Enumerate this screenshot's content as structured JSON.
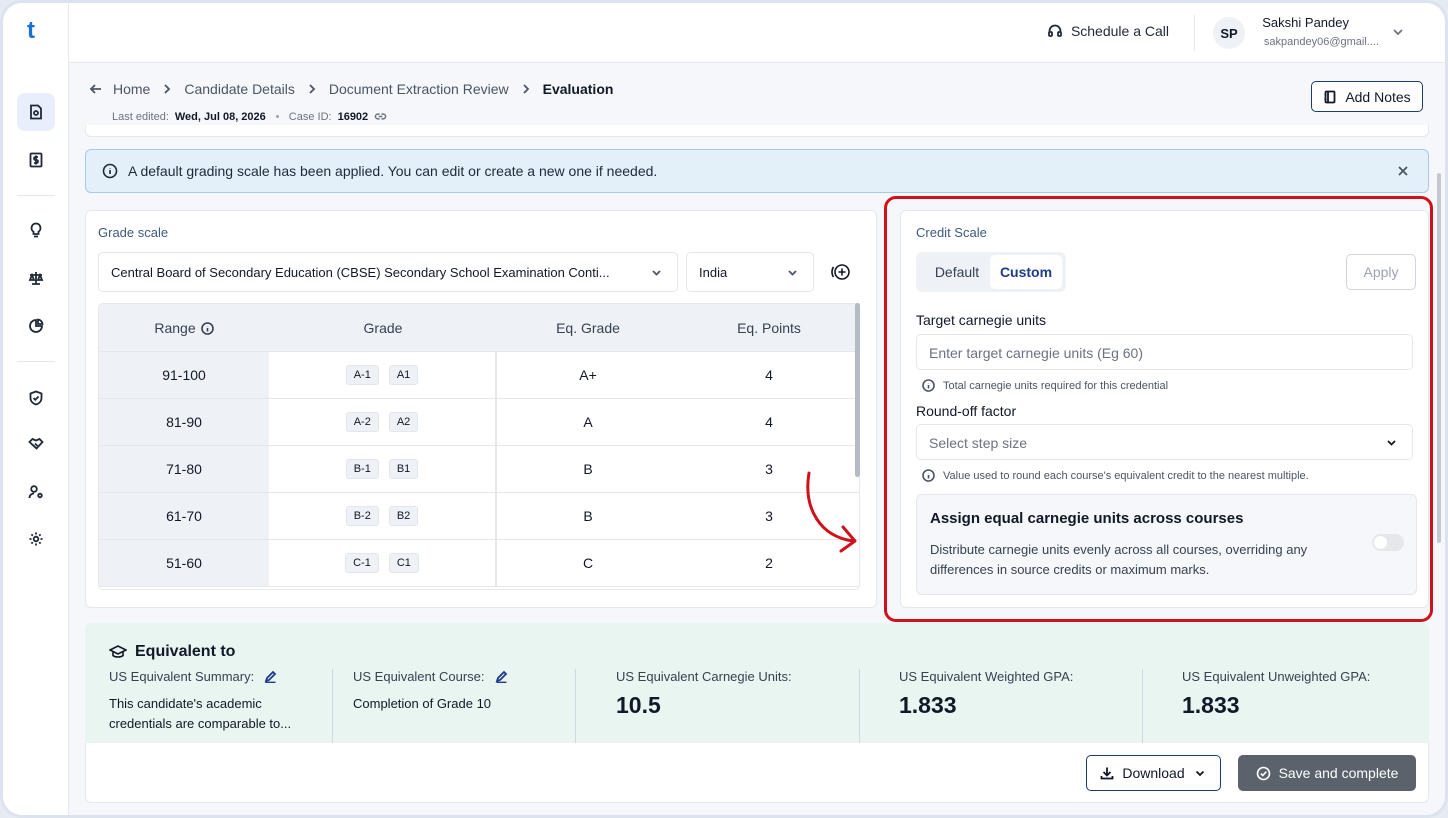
{
  "app": {
    "logo": "t"
  },
  "topbar": {
    "schedule_label": "Schedule a Call",
    "user_initials": "SP",
    "user_name": "Sakshi Pandey",
    "user_email": "sakpandey06@gmail...."
  },
  "breadcrumb": {
    "items": [
      "Home",
      "Candidate Details",
      "Document Extraction Review"
    ],
    "current": "Evaluation"
  },
  "meta": {
    "last_edited_label": "Last edited:",
    "last_edited_value": "Wed, Jul 08, 2026",
    "case_label": "Case ID:",
    "case_value": "16902"
  },
  "add_notes_label": "Add Notes",
  "alert": {
    "text": "A default grading scale has been applied. You can edit or create a new one if needed."
  },
  "grade_scale": {
    "title": "Grade scale",
    "board_value": "Central Board of Secondary Education (CBSE) Secondary School Examination Conti...",
    "country_value": "India",
    "columns": [
      "Range",
      "Grade",
      "Eq. Grade",
      "Eq. Points"
    ],
    "rows": [
      {
        "range": "91-100",
        "grades": [
          "A-1",
          "A1"
        ],
        "eq_grade": "A+",
        "eq_points": "4"
      },
      {
        "range": "81-90",
        "grades": [
          "A-2",
          "A2"
        ],
        "eq_grade": "A",
        "eq_points": "4"
      },
      {
        "range": "71-80",
        "grades": [
          "B-1",
          "B1"
        ],
        "eq_grade": "B",
        "eq_points": "3"
      },
      {
        "range": "61-70",
        "grades": [
          "B-2",
          "B2"
        ],
        "eq_grade": "B",
        "eq_points": "3"
      },
      {
        "range": "51-60",
        "grades": [
          "C-1",
          "C1"
        ],
        "eq_grade": "C",
        "eq_points": "2"
      }
    ]
  },
  "credit_scale": {
    "title": "Credit Scale",
    "tabs": [
      "Default",
      "Custom"
    ],
    "selected_tab": "Custom",
    "apply_label": "Apply",
    "target_label": "Target carnegie units",
    "target_placeholder": "Enter target carnegie units (Eg 60)",
    "target_hint": "Total carnegie units required for this credential",
    "round_label": "Round-off factor",
    "round_placeholder": "Select step size",
    "round_hint": "Value used to round each course's equivalent credit to the nearest multiple.",
    "assign_title": "Assign equal carnegie units across courses",
    "assign_desc": "Distribute carnegie units evenly across all courses, overriding any differences in source credits or maximum marks.",
    "assign_enabled": false
  },
  "equivalent": {
    "title": "Equivalent to",
    "summary_label": "US Equivalent Summary:",
    "summary_value": "This candidate's academic credentials are comparable to...",
    "course_label": "US Equivalent Course:",
    "course_value": "Completion of Grade 10",
    "carnegie_label": "US Equivalent Carnegie Units:",
    "carnegie_value": "10.5",
    "weighted_label": "US Equivalent Weighted GPA:",
    "weighted_value": "1.833",
    "unweighted_label": "US Equivalent Unweighted GPA:",
    "unweighted_value": "1.833"
  },
  "footer": {
    "download_label": "Download",
    "save_label": "Save and complete"
  },
  "colors": {
    "brand": "#1d6fd6",
    "highlight": "#d0111b",
    "equiv_bg": "#e9f5f1",
    "alert_bg": "#e3f0fa"
  }
}
